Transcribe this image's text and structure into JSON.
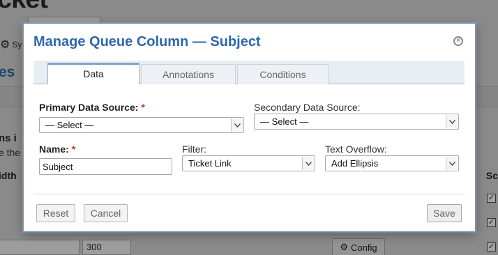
{
  "background": {
    "logo_text": "cket",
    "settings_label": "Sy",
    "heading": "es",
    "text_line1": "ns i",
    "text_line2": "e the",
    "width_header": "idth",
    "sc_header": "Sc",
    "width_input_value": "300",
    "config_button_label": "Config",
    "checkmark": "✓"
  },
  "modal": {
    "title": "Manage Queue Column — Subject",
    "close_icon": "close-icon",
    "tabs": [
      {
        "label": "Data",
        "active": true
      },
      {
        "label": "Annotations",
        "active": false
      },
      {
        "label": "Conditions",
        "active": false
      }
    ],
    "fields": {
      "primary_source": {
        "label": "Primary Data Source:",
        "required_mark": "*",
        "selected": "— Select —"
      },
      "secondary_source": {
        "label": "Secondary Data Source:",
        "selected": "— Select —"
      },
      "name": {
        "label": "Name:",
        "required_mark": "*",
        "value": "Subject"
      },
      "filter": {
        "label": "Filter:",
        "selected": "Ticket Link"
      },
      "text_overflow": {
        "label": "Text Overflow:",
        "selected": "Add Ellipsis"
      }
    },
    "buttons": {
      "reset": "Reset",
      "cancel": "Cancel",
      "save": "Save"
    }
  },
  "colors": {
    "title": "#2e67ad",
    "required": "#c0392b",
    "modal_border": "#6f92c9"
  }
}
